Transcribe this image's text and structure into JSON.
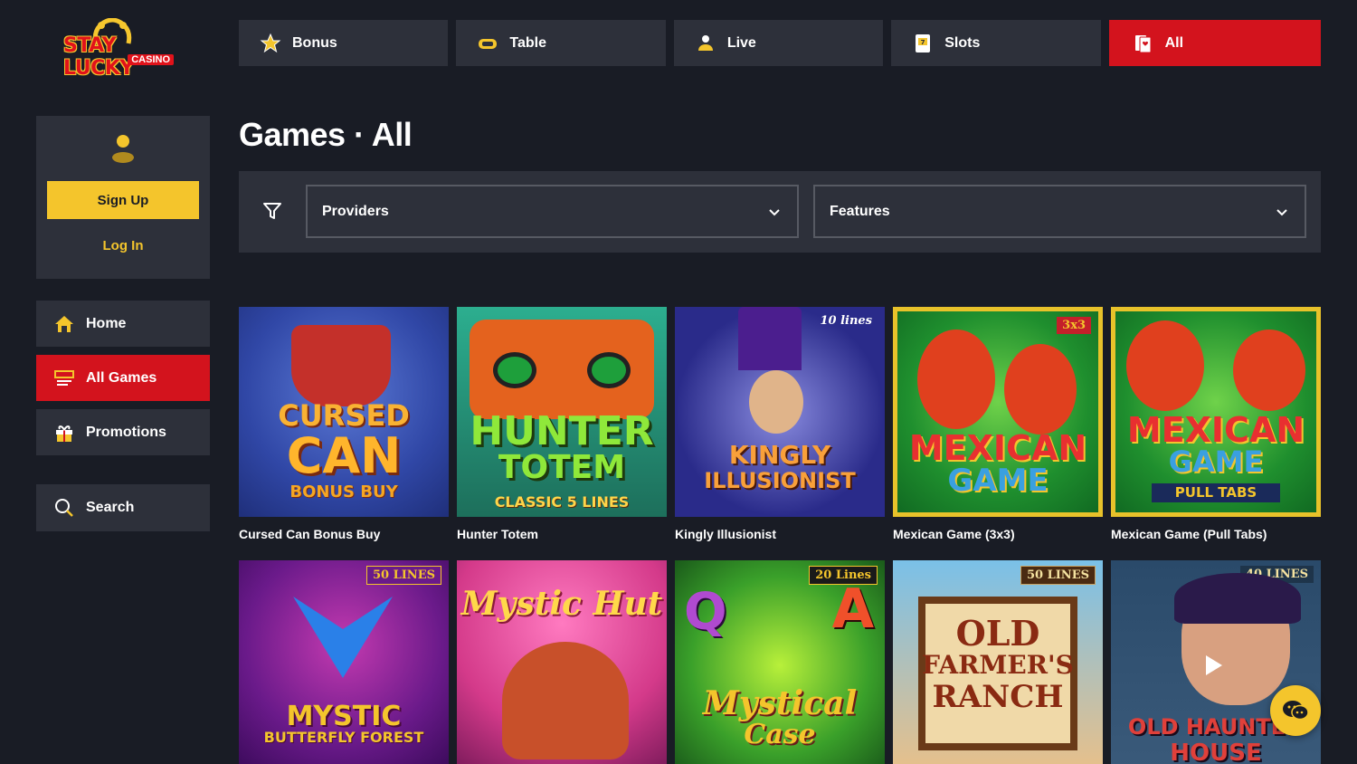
{
  "brand": {
    "name": "STAY LUCKY",
    "sub": "CASINO"
  },
  "topnav": {
    "tabs": [
      {
        "label": "Bonus",
        "icon": "star-icon"
      },
      {
        "label": "Table",
        "icon": "chip-icon"
      },
      {
        "label": "Live",
        "icon": "dealer-icon"
      },
      {
        "label": "Slots",
        "icon": "slot-machine-icon"
      },
      {
        "label": "All",
        "icon": "cards-icon",
        "active": true
      }
    ]
  },
  "user": {
    "signup_label": "Sign Up",
    "login_label": "Log In"
  },
  "sidebar": {
    "items": [
      {
        "label": "Home",
        "icon": "home-icon"
      },
      {
        "label": "All Games",
        "icon": "games-icon",
        "active": true
      },
      {
        "label": "Promotions",
        "icon": "gift-icon"
      }
    ],
    "search_label": "Search"
  },
  "page": {
    "title": "Games · All"
  },
  "filters": {
    "providers_label": "Providers",
    "features_label": "Features"
  },
  "games": [
    {
      "name": "Cursed Can Bonus Buy",
      "art_lines": [
        "CURSED",
        "CAN",
        "BONUS BUY"
      ]
    },
    {
      "name": "Hunter Totem",
      "art_lines": [
        "HUNTER",
        "TOTEM",
        "CLASSIC 5 LINES"
      ]
    },
    {
      "name": "Kingly Illusionist",
      "badge": "10 lines",
      "art_lines": [
        "KINGLY",
        "ILLUSIONIST"
      ]
    },
    {
      "name": "Mexican Game (3x3)",
      "badge": "3x3",
      "art_lines": [
        "MEXICAN",
        "GAME"
      ]
    },
    {
      "name": "Mexican Game (Pull Tabs)",
      "art_lines": [
        "MEXICAN",
        "GAME",
        "PULL TABS"
      ]
    },
    {
      "name": "",
      "badge": "50 LINES",
      "art_lines": [
        "MYSTIC",
        "BUTTERFLY FOREST"
      ]
    },
    {
      "name": "",
      "art_lines": [
        "Mystic Hut"
      ]
    },
    {
      "name": "",
      "badge": "20 Lines",
      "art_lines": [
        "Mystical",
        "Case"
      ]
    },
    {
      "name": "",
      "badge": "50 LINES",
      "art_lines": [
        "OLD",
        "FARMER'S",
        "RANCH"
      ]
    },
    {
      "name": "",
      "badge": "40 LINES",
      "art_lines": [
        "OLD HAUNTED",
        "HOUSE"
      ]
    }
  ],
  "colors": {
    "background": "#191c25",
    "panel": "#2d303a",
    "accent_red": "#d3131d",
    "accent_yellow": "#f4c52c"
  }
}
